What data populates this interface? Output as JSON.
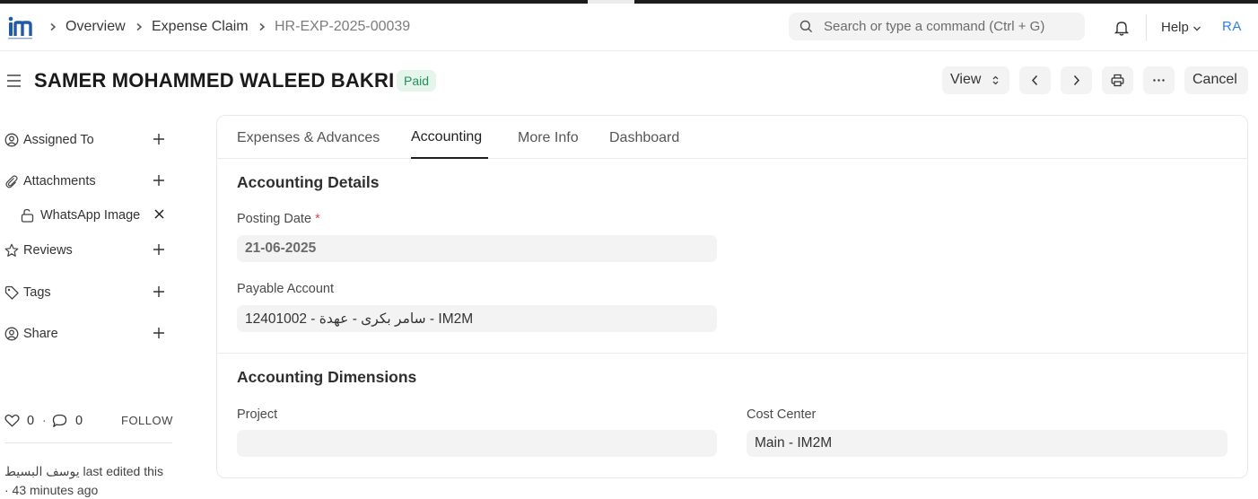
{
  "breadcrumbs": {
    "overview": "Overview",
    "doctype": "Expense Claim",
    "docname": "HR-EXP-2025-00039"
  },
  "search": {
    "placeholder": "Search or type a command (Ctrl + G)"
  },
  "navbar": {
    "help": "Help",
    "avatar": "RA"
  },
  "header": {
    "title": "SAMER MOHAMMED WALEED BAKRI",
    "status": "Paid",
    "view_label": "View",
    "cancel_label": "Cancel"
  },
  "sidebar": {
    "items": [
      {
        "label": "Assigned To",
        "icon": "assign-icon"
      },
      {
        "label": "Attachments",
        "icon": "paperclip-icon"
      },
      {
        "label": "Reviews",
        "icon": "star-icon"
      },
      {
        "label": "Tags",
        "icon": "tag-icon"
      },
      {
        "label": "Share",
        "icon": "share-icon"
      }
    ],
    "attachment": "WhatsApp Image",
    "likes": "0",
    "comments": "0",
    "separator": "·",
    "follow": "FOLLOW",
    "edited_line1": "يوسف البسيط last edited this",
    "edited_line2": "· 43 minutes ago"
  },
  "tabs": [
    "Expenses & Advances",
    "Accounting",
    "More Info",
    "Dashboard"
  ],
  "accounting_details": {
    "title": "Accounting Details",
    "posting_date_label": "Posting Date",
    "required_mark": "*",
    "posting_date_value": "21-06-2025",
    "payable_account_label": "Payable Account",
    "payable_account_value": "12401002 - سامر بكرى - عهدة - IM2M"
  },
  "accounting_dimensions": {
    "title": "Accounting Dimensions",
    "project_label": "Project",
    "project_value": "",
    "cost_center_label": "Cost Center",
    "cost_center_value": "Main - IM2M"
  },
  "colors": {
    "accent": "#2f80ed",
    "status_bg": "#e4f5e9",
    "status_text": "#278f5e",
    "field_bg": "#f3f3f3"
  }
}
